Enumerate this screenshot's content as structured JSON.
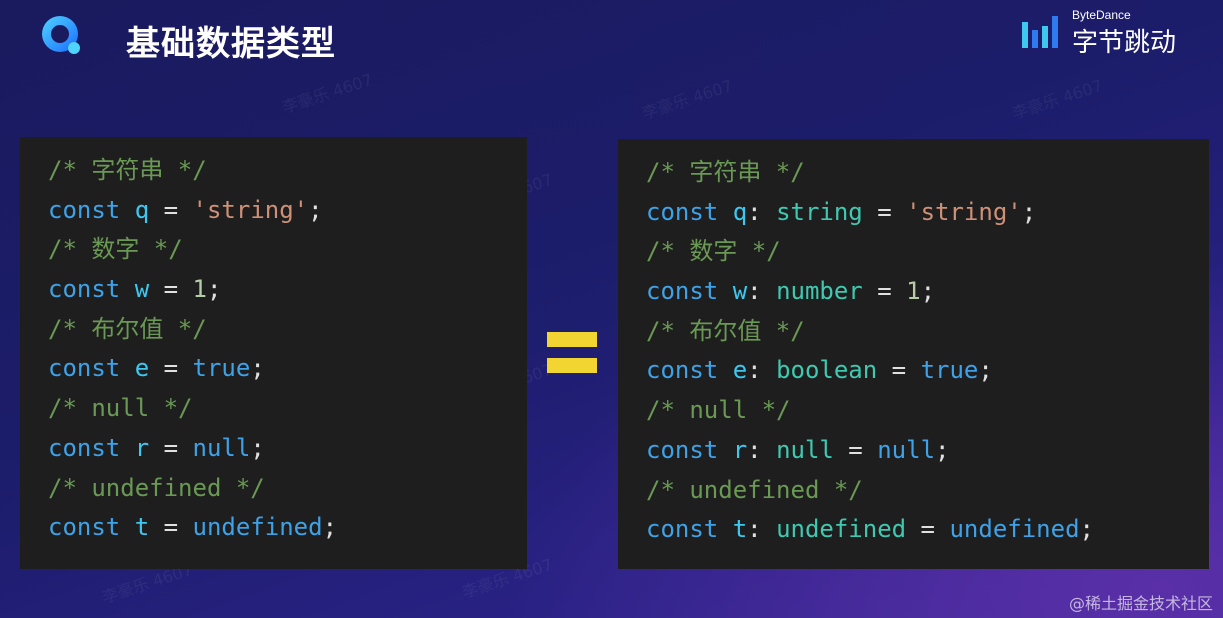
{
  "header": {
    "title": "基础数据类型",
    "brand_en": "ByteDance",
    "brand_cn": "字节跳动"
  },
  "watermark_text": "李豪乐 4607",
  "left_code": [
    [
      {
        "t": "comment",
        "v": "/* 字符串 */"
      }
    ],
    [
      {
        "t": "keyword",
        "v": "const"
      },
      {
        "t": "op",
        "v": " "
      },
      {
        "t": "var",
        "v": "q"
      },
      {
        "t": "op",
        "v": " = "
      },
      {
        "t": "string",
        "v": "'string'"
      },
      {
        "t": "punct",
        "v": ";"
      }
    ],
    [
      {
        "t": "comment",
        "v": "/* 数字 */"
      }
    ],
    [
      {
        "t": "keyword",
        "v": "const"
      },
      {
        "t": "op",
        "v": " "
      },
      {
        "t": "var",
        "v": "w"
      },
      {
        "t": "op",
        "v": " = "
      },
      {
        "t": "number",
        "v": "1"
      },
      {
        "t": "punct",
        "v": ";"
      }
    ],
    [
      {
        "t": "comment",
        "v": "/* 布尔值 */"
      }
    ],
    [
      {
        "t": "keyword",
        "v": "const"
      },
      {
        "t": "op",
        "v": " "
      },
      {
        "t": "var",
        "v": "e"
      },
      {
        "t": "op",
        "v": " = "
      },
      {
        "t": "literal",
        "v": "true"
      },
      {
        "t": "punct",
        "v": ";"
      }
    ],
    [
      {
        "t": "comment",
        "v": "/* null */"
      }
    ],
    [
      {
        "t": "keyword",
        "v": "const"
      },
      {
        "t": "op",
        "v": " "
      },
      {
        "t": "var",
        "v": "r"
      },
      {
        "t": "op",
        "v": " = "
      },
      {
        "t": "literal",
        "v": "null"
      },
      {
        "t": "punct",
        "v": ";"
      }
    ],
    [
      {
        "t": "comment",
        "v": "/* undefined */"
      }
    ],
    [
      {
        "t": "keyword",
        "v": "const"
      },
      {
        "t": "op",
        "v": " "
      },
      {
        "t": "var",
        "v": "t"
      },
      {
        "t": "op",
        "v": " = "
      },
      {
        "t": "literal",
        "v": "undefined"
      },
      {
        "t": "punct",
        "v": ";"
      }
    ]
  ],
  "right_code": [
    [
      {
        "t": "comment",
        "v": "/* 字符串 */"
      }
    ],
    [
      {
        "t": "keyword",
        "v": "const"
      },
      {
        "t": "op",
        "v": " "
      },
      {
        "t": "var",
        "v": "q"
      },
      {
        "t": "punct",
        "v": ": "
      },
      {
        "t": "type",
        "v": "string"
      },
      {
        "t": "op",
        "v": " = "
      },
      {
        "t": "string",
        "v": "'string'"
      },
      {
        "t": "punct",
        "v": ";"
      }
    ],
    [
      {
        "t": "comment",
        "v": "/* 数字 */"
      }
    ],
    [
      {
        "t": "keyword",
        "v": "const"
      },
      {
        "t": "op",
        "v": " "
      },
      {
        "t": "var",
        "v": "w"
      },
      {
        "t": "punct",
        "v": ": "
      },
      {
        "t": "type",
        "v": "number"
      },
      {
        "t": "op",
        "v": " = "
      },
      {
        "t": "number",
        "v": "1"
      },
      {
        "t": "punct",
        "v": ";"
      }
    ],
    [
      {
        "t": "comment",
        "v": "/* 布尔值 */"
      }
    ],
    [
      {
        "t": "keyword",
        "v": "const"
      },
      {
        "t": "op",
        "v": " "
      },
      {
        "t": "var",
        "v": "e"
      },
      {
        "t": "punct",
        "v": ": "
      },
      {
        "t": "type",
        "v": "boolean"
      },
      {
        "t": "op",
        "v": " = "
      },
      {
        "t": "literal",
        "v": "true"
      },
      {
        "t": "punct",
        "v": ";"
      }
    ],
    [
      {
        "t": "comment",
        "v": "/* null */"
      }
    ],
    [
      {
        "t": "keyword",
        "v": "const"
      },
      {
        "t": "op",
        "v": " "
      },
      {
        "t": "var",
        "v": "r"
      },
      {
        "t": "punct",
        "v": ": "
      },
      {
        "t": "type",
        "v": "null"
      },
      {
        "t": "op",
        "v": " = "
      },
      {
        "t": "literal",
        "v": "null"
      },
      {
        "t": "punct",
        "v": ";"
      }
    ],
    [
      {
        "t": "comment",
        "v": "/* undefined */"
      }
    ],
    [
      {
        "t": "keyword",
        "v": "const"
      },
      {
        "t": "op",
        "v": " "
      },
      {
        "t": "var",
        "v": "t"
      },
      {
        "t": "punct",
        "v": ": "
      },
      {
        "t": "type",
        "v": "undefined"
      },
      {
        "t": "op",
        "v": " = "
      },
      {
        "t": "literal",
        "v": "undefined"
      },
      {
        "t": "punct",
        "v": ";"
      }
    ]
  ],
  "equals_color": "#f2d530",
  "footer": "@稀土掘金技术社区",
  "icons": {
    "app_logo": "app-logo-icon",
    "brand_logo": "bytedance-bars-icon",
    "equals": "equals-icon"
  }
}
